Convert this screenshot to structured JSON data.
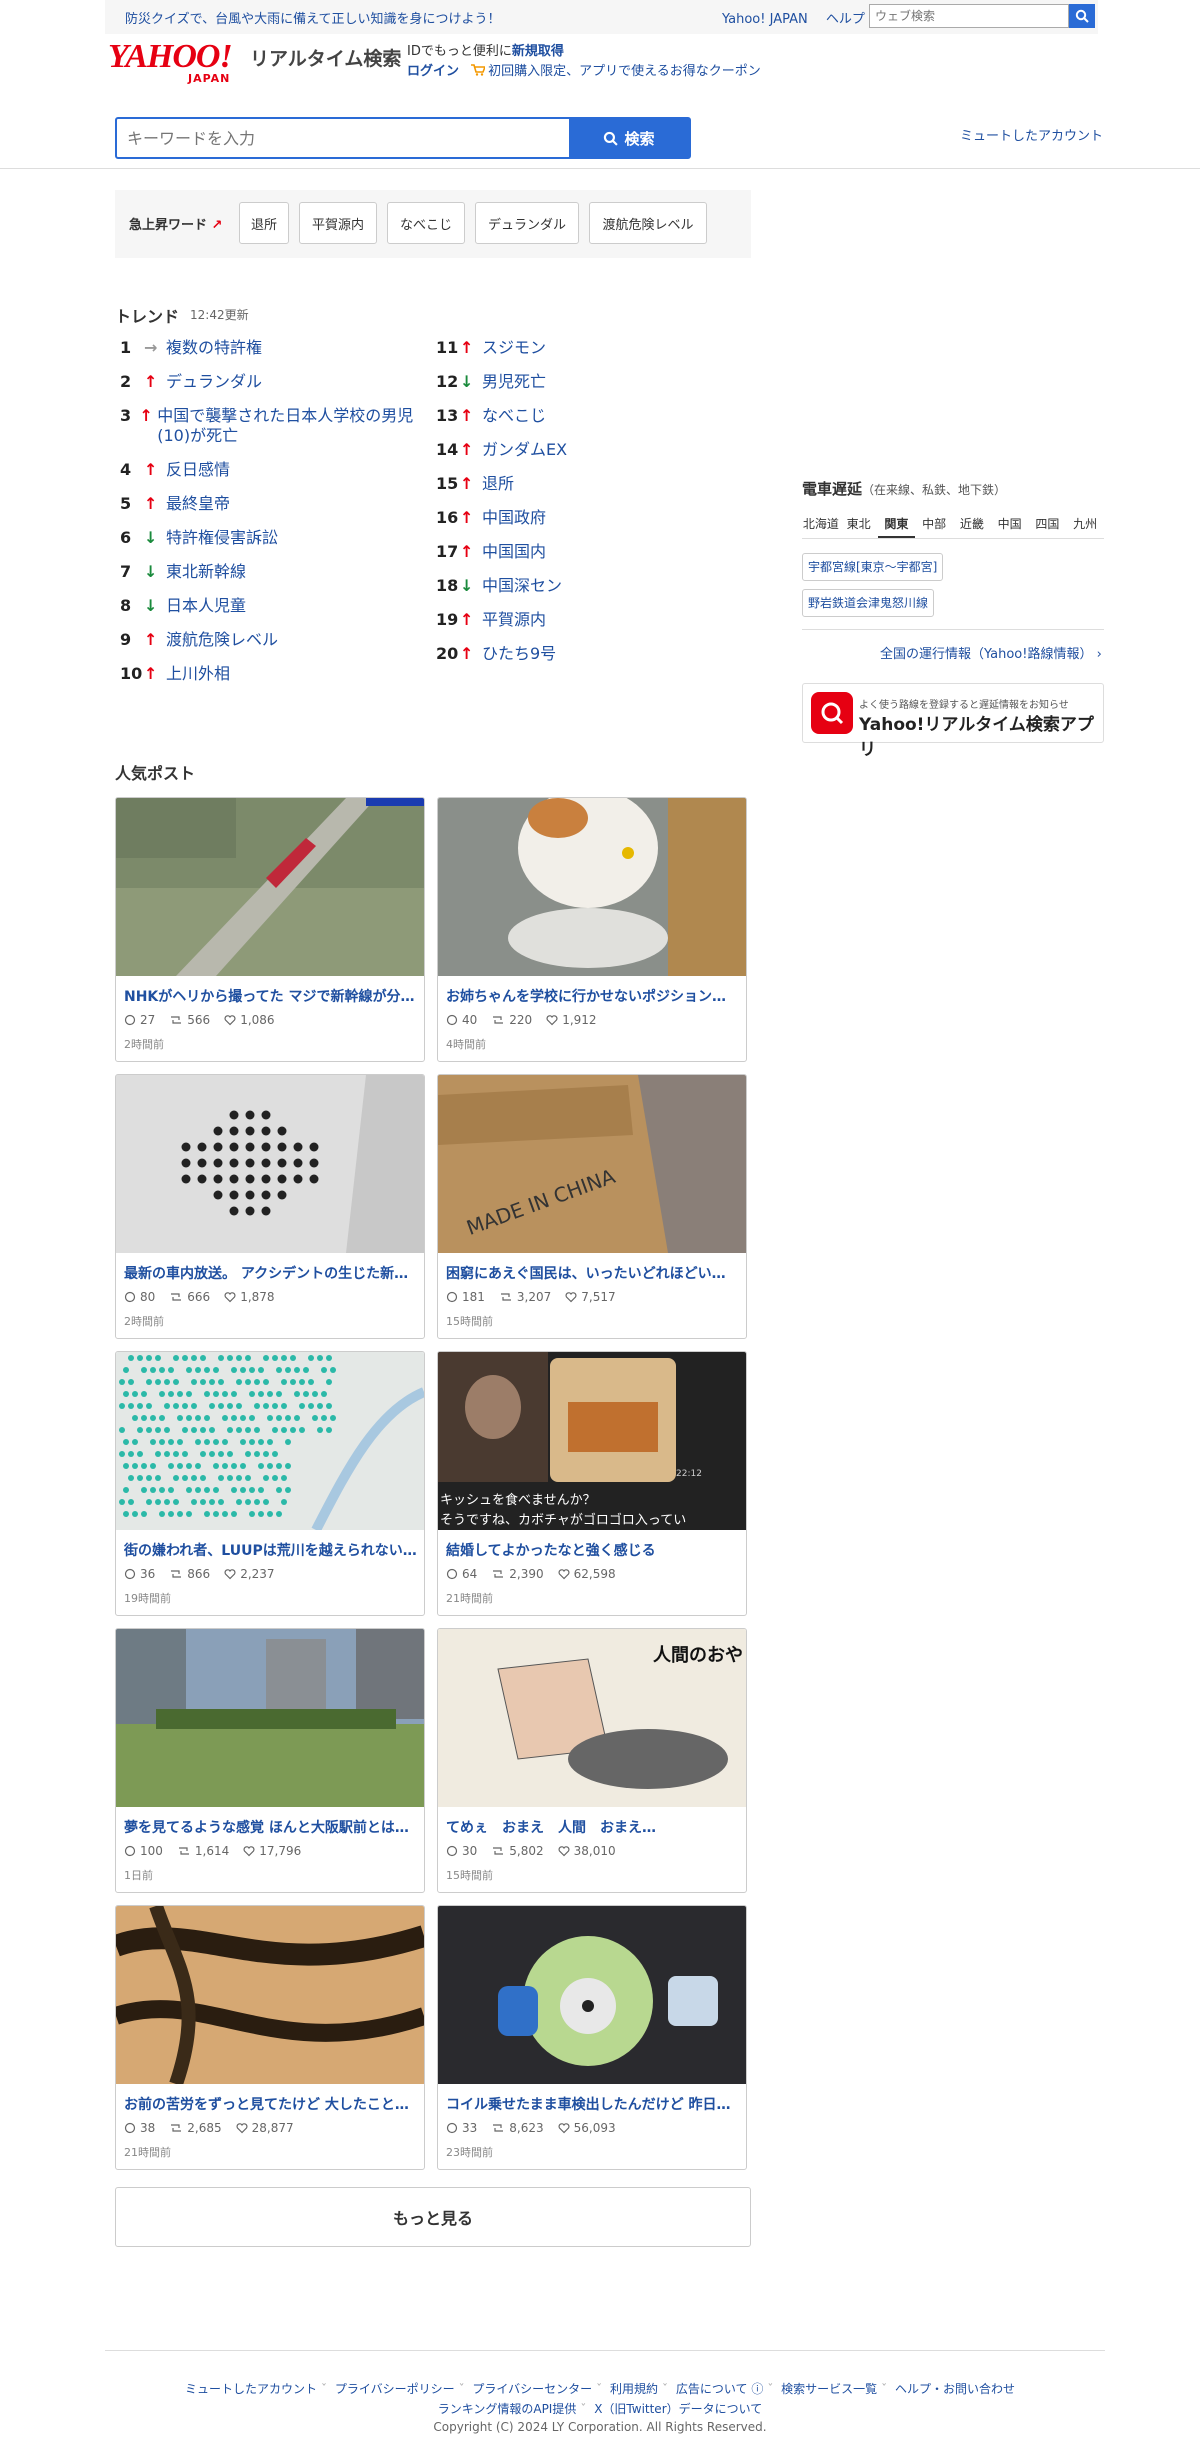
{
  "topbar": {
    "notice": "防災クイズで、台風や大雨に備えて正しい知識を身につけよう！",
    "yahoo_japan": "Yahoo! JAPAN",
    "help": "ヘルプ",
    "web_search_placeholder": "ウェブ検索"
  },
  "header": {
    "logo": "YAHOO!",
    "logo_sub": "JAPAN",
    "service_name": "リアルタイム検索",
    "id_text_prefix": "IDでもっと便利に",
    "signup": "新規取得",
    "login": "ログイン",
    "coupon": "初回購入限定、アプリで使えるお得なクーポン"
  },
  "search": {
    "placeholder": "キーワードを入力",
    "button": "検索",
    "muted_accounts": "ミュートしたアカウント"
  },
  "rising": {
    "label": "急上昇ワード",
    "words": [
      "退所",
      "平賀源内",
      "なべこじ",
      "デュランダル",
      "渡航危険レベル"
    ]
  },
  "trends": {
    "title": "トレンド",
    "updated": "12:42更新",
    "items": [
      {
        "rank": "1",
        "dir": "→",
        "cls": "flat",
        "kw": "複数の特許権"
      },
      {
        "rank": "2",
        "dir": "↑",
        "cls": "up",
        "kw": "デュランダル"
      },
      {
        "rank": "3",
        "dir": "↑",
        "cls": "up",
        "kw": "中国で襲撃された日本人学校の男児(10)が死亡"
      },
      {
        "rank": "4",
        "dir": "↑",
        "cls": "up",
        "kw": "反日感情"
      },
      {
        "rank": "5",
        "dir": "↑",
        "cls": "up",
        "kw": "最終皇帝"
      },
      {
        "rank": "6",
        "dir": "↓",
        "cls": "down",
        "kw": "特許権侵害訴訟"
      },
      {
        "rank": "7",
        "dir": "↓",
        "cls": "down",
        "kw": "東北新幹線"
      },
      {
        "rank": "8",
        "dir": "↓",
        "cls": "down",
        "kw": "日本人児童"
      },
      {
        "rank": "9",
        "dir": "↑",
        "cls": "up",
        "kw": "渡航危険レベル"
      },
      {
        "rank": "10",
        "dir": "↑",
        "cls": "up",
        "kw": "上川外相"
      },
      {
        "rank": "11",
        "dir": "↑",
        "cls": "up",
        "kw": "スジモン"
      },
      {
        "rank": "12",
        "dir": "↓",
        "cls": "down",
        "kw": "男児死亡"
      },
      {
        "rank": "13",
        "dir": "↑",
        "cls": "up",
        "kw": "なべこじ"
      },
      {
        "rank": "14",
        "dir": "↑",
        "cls": "up",
        "kw": "ガンダムEX"
      },
      {
        "rank": "15",
        "dir": "↑",
        "cls": "up",
        "kw": "退所"
      },
      {
        "rank": "16",
        "dir": "↑",
        "cls": "up",
        "kw": "中国政府"
      },
      {
        "rank": "17",
        "dir": "↑",
        "cls": "up",
        "kw": "中国国内"
      },
      {
        "rank": "18",
        "dir": "↓",
        "cls": "down",
        "kw": "中国深セン"
      },
      {
        "rank": "19",
        "dir": "↑",
        "cls": "up",
        "kw": "平賀源内"
      },
      {
        "rank": "20",
        "dir": "↑",
        "cls": "up",
        "kw": "ひたち9号"
      }
    ]
  },
  "popular": {
    "title": "人気ポスト",
    "posts": [
      {
        "title": "NHKがヘリから撮ってた マジで新幹線が分…",
        "replies": "27",
        "reposts": "566",
        "likes": "1,086",
        "age": "2時間前",
        "img": "train"
      },
      {
        "title": "お姉ちゃんを学校に行かせないポジション…",
        "replies": "40",
        "reposts": "220",
        "likes": "1,912",
        "age": "4時間前",
        "img": "cat"
      },
      {
        "title": "最新の車内放送。 アクシデントの生じた新…",
        "replies": "80",
        "reposts": "666",
        "likes": "1,878",
        "age": "2時間前",
        "img": "speaker"
      },
      {
        "title": "困窮にあえぐ国民は、いったいどれほどい…",
        "replies": "181",
        "reposts": "3,207",
        "likes": "7,517",
        "age": "15時間前",
        "img": "box"
      },
      {
        "title": "街の嫌われ者、LUUPは荒川を越えられない…",
        "replies": "36",
        "reposts": "866",
        "likes": "2,237",
        "age": "19時間前",
        "img": "map"
      },
      {
        "title": "結婚してよかったなと強く感じる",
        "replies": "64",
        "reposts": "2,390",
        "likes": "62,598",
        "age": "21時間前",
        "img": "quiche"
      },
      {
        "title": "夢を見てるような感覚 ほんと大阪駅前とは…",
        "replies": "100",
        "reposts": "1,614",
        "likes": "17,796",
        "age": "1日前",
        "img": "park"
      },
      {
        "title": "てめぇ　おまえ　人間　おまえ…",
        "replies": "30",
        "reposts": "5,802",
        "likes": "38,010",
        "age": "15時間前",
        "img": "manga"
      },
      {
        "title": "お前の苦労をずっと見てたけど 大したこと…",
        "replies": "38",
        "reposts": "2,685",
        "likes": "28,877",
        "age": "21時間前",
        "img": "tiger"
      },
      {
        "title": "コイル乗せたまま車検出したんだけど 昨日…",
        "replies": "33",
        "reposts": "8,623",
        "likes": "56,093",
        "age": "23時間前",
        "img": "plush"
      }
    ],
    "overlay_texts": {
      "quiche_line1": "キッシュを食べませんか？",
      "quiche_line2": "そうですね、カボチャがゴロゴロ入ってい",
      "quiche_time": "22:12",
      "manga_caption": "人間のおや",
      "box_text": "MADE IN CHINA"
    },
    "more": "もっと見る"
  },
  "rail": {
    "title": "電車遅延",
    "subtitle": "（在来線、私鉄、地下鉄）",
    "regions": [
      "北海道",
      "東北",
      "関東",
      "中部",
      "近畿",
      "中国",
      "四国",
      "九州"
    ],
    "active_region": "関東",
    "delays": [
      "宇都宮線[東京〜宇都宮]",
      "野岩鉄道会津鬼怒川線"
    ],
    "all_info": "全国の運行情報（Yahoo!路線情報）",
    "app_sub": "よく使う路線を登録すると遅延情報をお知らせ",
    "app_name": "Yahoo!リアルタイム検索アプリ"
  },
  "footer": {
    "links1": [
      "ミュートしたアカウント",
      "プライバシーポリシー",
      "プライバシーセンター",
      "利用規約",
      "広告について",
      "検索サービス一覧",
      "ヘルプ・お問い合わせ"
    ],
    "links2": [
      "ランキング情報のAPI提供",
      "X（旧Twitter）データについて"
    ],
    "copyright": "Copyright (C) 2024 LY Corporation. All Rights Reserved."
  },
  "colors": {
    "accent": "#2a6bd6",
    "link": "#1f4fa0",
    "up": "#e60012",
    "down": "#1a8a3c",
    "brand": "#e60012"
  }
}
